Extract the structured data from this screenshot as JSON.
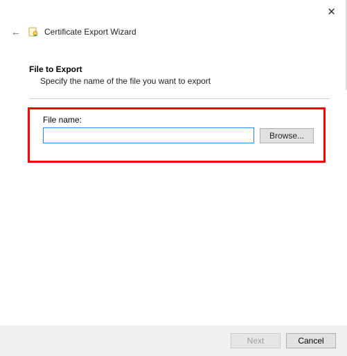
{
  "window": {
    "title": "Certificate Export Wizard"
  },
  "section": {
    "heading": "File to Export",
    "description": "Specify the name of the file you want to export"
  },
  "form": {
    "file_label": "File name:",
    "file_value": "",
    "browse_label": "Browse..."
  },
  "footer": {
    "next_label": "Next",
    "cancel_label": "Cancel"
  }
}
